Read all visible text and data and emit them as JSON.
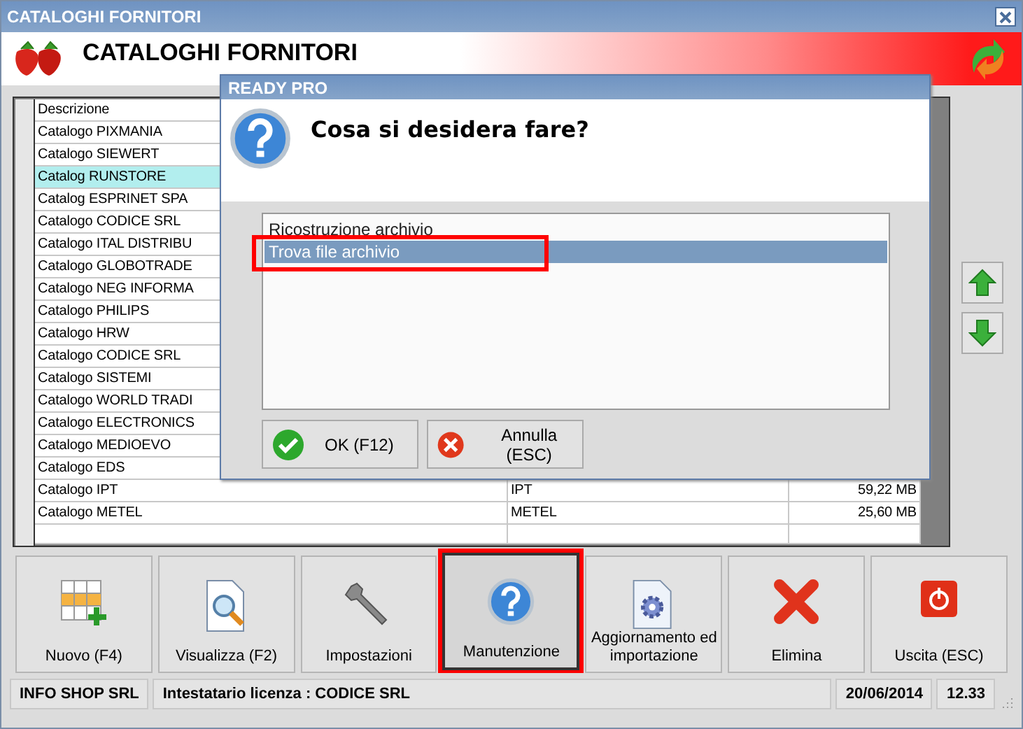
{
  "window": {
    "title": "CATALOGHI FORNITORI",
    "header_title": "CATALOGHI FORNITORI"
  },
  "table": {
    "columns": [
      "Descrizione"
    ],
    "rows": [
      {
        "description": "Catalogo PIXMANIA",
        "selected": false
      },
      {
        "description": "Catalogo SIEWERT",
        "selected": false
      },
      {
        "description": "Catalog RUNSTORE",
        "selected": true
      },
      {
        "description": "Catalog ESPRINET SPA",
        "selected": false
      },
      {
        "description": "Catalogo CODICE SRL",
        "selected": false
      },
      {
        "description": "Catalogo ITAL DISTRIBU",
        "selected": false
      },
      {
        "description": "Catalogo GLOBOTRADE",
        "selected": false
      },
      {
        "description": "Catalogo NEG INFORMA",
        "selected": false
      },
      {
        "description": "Catalogo PHILIPS",
        "selected": false
      },
      {
        "description": "Catalogo HRW",
        "selected": false
      },
      {
        "description": "Catalogo CODICE SRL",
        "selected": false
      },
      {
        "description": "Catalogo SISTEMI",
        "selected": false
      },
      {
        "description": "Catalogo WORLD TRADI",
        "selected": false
      },
      {
        "description": "Catalogo ELECTRONICS",
        "selected": false
      },
      {
        "description": "Catalogo MEDIOEVO",
        "selected": false
      },
      {
        "description": "Catalogo EDS",
        "selected": false
      },
      {
        "description": "Catalogo IPT",
        "code": "IPT",
        "size": "59,22 MB",
        "selected": false
      },
      {
        "description": "Catalogo METEL",
        "code": "METEL",
        "size": "25,60 MB",
        "selected": false
      }
    ]
  },
  "toolbar": [
    {
      "label": "Nuovo (F4)",
      "pressed": false,
      "highlighted": false
    },
    {
      "label": "Visualizza (F2)",
      "pressed": false,
      "highlighted": false
    },
    {
      "label": "Impostazioni",
      "pressed": false,
      "highlighted": false
    },
    {
      "label": "Manutenzione",
      "pressed": true,
      "highlighted": true
    },
    {
      "label": "Aggiornamento ed importazione",
      "pressed": false,
      "highlighted": false
    },
    {
      "label": "Elimina",
      "pressed": false,
      "highlighted": false
    },
    {
      "label": "Uscita (ESC)",
      "pressed": false,
      "highlighted": false
    }
  ],
  "status_bar": [
    "INFO SHOP SRL",
    "Intestatario licenza : CODICE SRL",
    "20/06/2014",
    "12.33"
  ],
  "dialog": {
    "title": "READY PRO",
    "question": "Cosa si desidera fare?",
    "options": [
      {
        "label": "Ricostruzione archivio",
        "selected": false,
        "highlighted": false
      },
      {
        "label": "Trova file archivio",
        "selected": true,
        "highlighted": true
      }
    ],
    "buttons": [
      {
        "label": "OK (F12)",
        "kind": "ok"
      },
      {
        "label": "Annulla (ESC)",
        "kind": "cancel"
      }
    ]
  }
}
